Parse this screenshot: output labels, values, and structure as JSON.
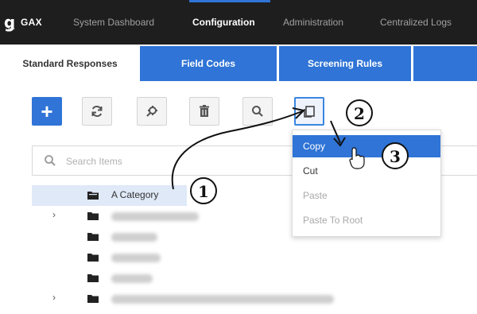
{
  "nav": {
    "logo_text": "GAX",
    "items": [
      "System Dashboard",
      "Configuration",
      "Administration",
      "Centralized Logs"
    ],
    "active": "Configuration"
  },
  "tabs": [
    "Standard Responses",
    "Field Codes",
    "Screening Rules"
  ],
  "toolbar": {
    "add_label": "+",
    "icons": [
      "plus-icon",
      "refresh-icon",
      "settings-icon",
      "trash-icon",
      "search-icon",
      "copy-icon"
    ]
  },
  "search": {
    "placeholder": "Search Items"
  },
  "tree": {
    "selected_label": "A Category"
  },
  "context_menu": {
    "items": [
      "Copy",
      "Cut",
      "Paste",
      "Paste To Root"
    ],
    "highlighted": "Copy",
    "disabled": [
      "Paste",
      "Paste To Root"
    ]
  },
  "annotations": {
    "step1": "1",
    "step2": "2",
    "step3": "3"
  },
  "colors": {
    "accent": "#2f74d6",
    "topbar": "#1e1e1e",
    "selection": "#dfe9f7"
  }
}
